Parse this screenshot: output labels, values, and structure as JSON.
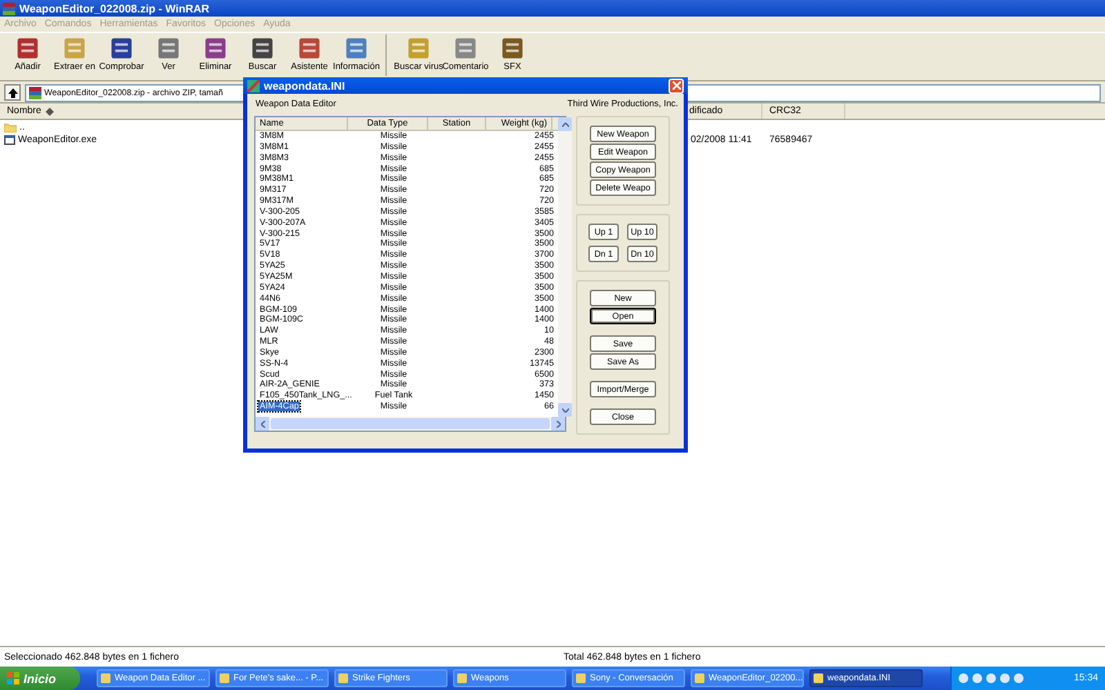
{
  "window": {
    "title": "WeaponEditor_022008.zip - WinRAR"
  },
  "menu": [
    "Archivo",
    "Comandos",
    "Herramientas",
    "Favoritos",
    "Opciones",
    "Ayuda"
  ],
  "toolbar": [
    [
      "Añadir",
      "Extraer en",
      "Comprobar",
      "Ver",
      "Eliminar",
      "Buscar",
      "Asistente",
      "Información"
    ],
    [
      "Buscar virus",
      "Comentario",
      "SFX"
    ]
  ],
  "address": {
    "value": "WeaponEditor_022008.zip - archivo ZIP, tamañ"
  },
  "file_list": {
    "columns": [
      "Nombre",
      "dificado",
      "CRC32"
    ],
    "rows": [
      {
        "name": ".."
      },
      {
        "name": "WeaponEditor.exe",
        "column_2": "02/2008 11:41",
        "crc32": "76589467"
      }
    ]
  },
  "status_bar": {
    "selected": "Seleccionado 462.848 bytes en 1 fichero",
    "total": "Total 462.848 bytes en 1 fichero"
  },
  "dialog": {
    "title": "weapondata.INI",
    "heading": "Weapon Data Editor",
    "company": "Third Wire Productions, Inc.",
    "table": {
      "columns": [
        "Name",
        "Data Type",
        "Station",
        "Weight (kg)"
      ],
      "rows": [
        {
          "name": "3M8M",
          "type": "Missile",
          "weight": "2455",
          "selected": false
        },
        {
          "name": "3M8M1",
          "type": "Missile",
          "weight": "2455",
          "selected": false
        },
        {
          "name": "3M8M3",
          "type": "Missile",
          "weight": "2455",
          "selected": false
        },
        {
          "name": "9M38",
          "type": "Missile",
          "weight": "685",
          "selected": false
        },
        {
          "name": "9M38M1",
          "type": "Missile",
          "weight": "685",
          "selected": false
        },
        {
          "name": "9M317",
          "type": "Missile",
          "weight": "720",
          "selected": false
        },
        {
          "name": "9M317M",
          "type": "Missile",
          "weight": "720",
          "selected": false
        },
        {
          "name": "V-300-205",
          "type": "Missile",
          "weight": "3585",
          "selected": false
        },
        {
          "name": "V-300-207A",
          "type": "Missile",
          "weight": "3405",
          "selected": false
        },
        {
          "name": "V-300-215",
          "type": "Missile",
          "weight": "3500",
          "selected": false
        },
        {
          "name": "5V17",
          "type": "Missile",
          "weight": "3500",
          "selected": false
        },
        {
          "name": "5V18",
          "type": "Missile",
          "weight": "3700",
          "selected": false
        },
        {
          "name": "5YA25",
          "type": "Missile",
          "weight": "3500",
          "selected": false
        },
        {
          "name": "5YA25M",
          "type": "Missile",
          "weight": "3500",
          "selected": false
        },
        {
          "name": "5YA24",
          "type": "Missile",
          "weight": "3500",
          "selected": false
        },
        {
          "name": "44N6",
          "type": "Missile",
          "weight": "3500",
          "selected": false
        },
        {
          "name": "BGM-109",
          "type": "Missile",
          "weight": "1400",
          "selected": false
        },
        {
          "name": "BGM-109C",
          "type": "Missile",
          "weight": "1400",
          "selected": false
        },
        {
          "name": "LAW",
          "type": "Missile",
          "weight": "10",
          "selected": false
        },
        {
          "name": "MLR",
          "type": "Missile",
          "weight": "48",
          "selected": false
        },
        {
          "name": "Skye",
          "type": "Missile",
          "weight": "2300",
          "selected": false
        },
        {
          "name": "SS-N-4",
          "type": "Missile",
          "weight": "13745",
          "selected": false
        },
        {
          "name": "Scud",
          "type": "Missile",
          "weight": "6500",
          "selected": false
        },
        {
          "name": "AIR-2A_GENIE",
          "type": "Missile",
          "weight": "373",
          "selected": false
        },
        {
          "name": "F105_450Tank_LNG_...",
          "type": "Fuel Tank",
          "weight": "1450",
          "selected": false
        },
        {
          "name": "AIM-4Cap",
          "type": "Missile",
          "weight": "66",
          "selected": true
        }
      ]
    },
    "button_groups": [
      [
        {
          "label": "New Weapon",
          "focused": false
        },
        {
          "label": "Edit Weapon",
          "focused": false
        },
        {
          "label": "Copy Weapon",
          "focused": false
        },
        {
          "label": "Delete Weapo",
          "focused": false
        }
      ],
      [
        {
          "label": "Up 1",
          "focused": false
        },
        {
          "label": "Up 10",
          "focused": false
        },
        {
          "label": "Dn 1",
          "focused": false
        },
        {
          "label": "Dn 10",
          "focused": false
        }
      ],
      [
        {
          "label": "New",
          "focused": false
        },
        {
          "label": "Open",
          "focused": true
        },
        {
          "label": "Save",
          "focused": false
        },
        {
          "label": "Save As",
          "focused": false
        },
        {
          "label": "Import/Merge",
          "focused": false
        },
        {
          "label": "Close",
          "focused": false
        }
      ]
    ]
  },
  "taskbar": {
    "start": "Inicio",
    "items": [
      {
        "label": "Weapon Data Editor ...",
        "selected": false
      },
      {
        "label": "For Pete's sake... - P...",
        "selected": false
      },
      {
        "label": "Strike Fighters",
        "selected": false
      },
      {
        "label": "Weapons",
        "selected": false
      },
      {
        "label": "Sony - Conversación",
        "selected": false
      },
      {
        "label": "WeaponEditor_02200...",
        "selected": false
      },
      {
        "label": "weapondata.INI",
        "selected": true
      }
    ],
    "clock": "15:34"
  }
}
